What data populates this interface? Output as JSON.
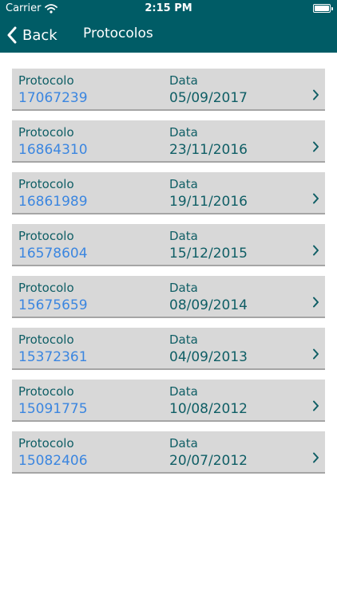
{
  "status_bar": {
    "carrier": "Carrier",
    "time": "2:15 PM"
  },
  "nav": {
    "back_label": "Back",
    "title": "Protocolos"
  },
  "list_labels": {
    "protocol": "Protocolo",
    "date": "Data"
  },
  "protocols": [
    {
      "number": "17067239",
      "date": "05/09/2017"
    },
    {
      "number": "16864310",
      "date": "23/11/2016"
    },
    {
      "number": "16861989",
      "date": "19/11/2016"
    },
    {
      "number": "16578604",
      "date": "15/12/2015"
    },
    {
      "number": "15675659",
      "date": "08/09/2014"
    },
    {
      "number": "15372361",
      "date": "04/09/2013"
    },
    {
      "number": "15091775",
      "date": "10/08/2012"
    },
    {
      "number": "15082406",
      "date": "20/07/2012"
    }
  ],
  "colors": {
    "header_bg": "#005c66",
    "row_bg": "#d8d8d8",
    "label_color": "#0f5e65",
    "protocol_color": "#3b86e0"
  }
}
